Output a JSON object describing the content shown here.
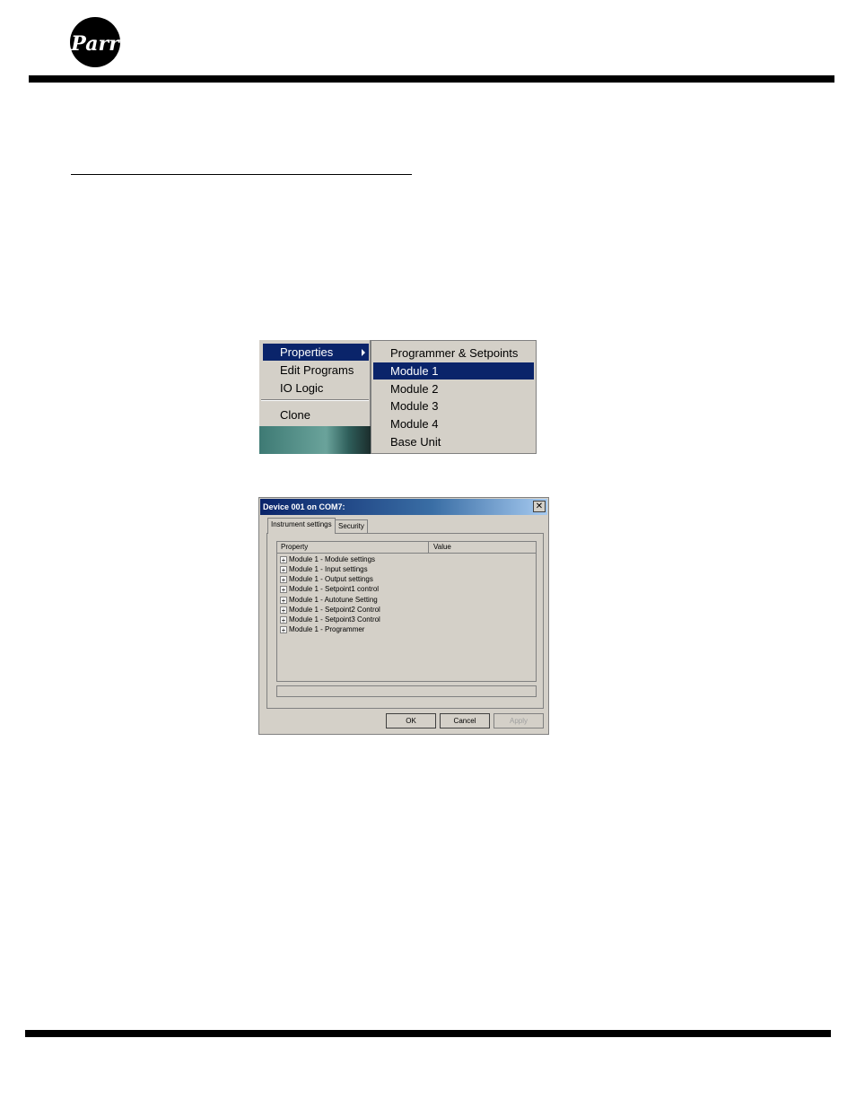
{
  "header": {
    "logo_text": "Parr"
  },
  "context_menu": {
    "items": [
      {
        "label": "Properties",
        "selected": true,
        "has_submenu": true
      },
      {
        "label": "Edit Programs"
      },
      {
        "label": "IO Logic"
      },
      {
        "label": "Clone"
      }
    ],
    "submenu": [
      {
        "label": "Programmer & Setpoints"
      },
      {
        "label": "Module 1",
        "selected": true
      },
      {
        "label": "Module 2"
      },
      {
        "label": "Module 3"
      },
      {
        "label": "Module 4"
      },
      {
        "label": "Base Unit"
      }
    ]
  },
  "dialog": {
    "title": "Device 001 on COM7:",
    "close_label": "✕",
    "tabs": [
      {
        "label": "Instrument settings",
        "active": true
      },
      {
        "label": "Security"
      }
    ],
    "columns": [
      "Property",
      "Value"
    ],
    "rows": [
      "Module 1 - Module settings",
      "Module 1 - Input settings",
      "Module 1 - Output settings",
      "Module 1 - Setpoint1 control",
      "Module 1 - Autotune Setting",
      "Module 1 - Setpoint2 Control",
      "Module 1 - Setpoint3 Control",
      "Module 1 - Programmer"
    ],
    "buttons": {
      "ok": "OK",
      "cancel": "Cancel",
      "apply": "Apply"
    }
  },
  "colors": {
    "menu_bg": "#d4d0c8",
    "selection": "#0a246a",
    "page_rule": "#000000"
  }
}
